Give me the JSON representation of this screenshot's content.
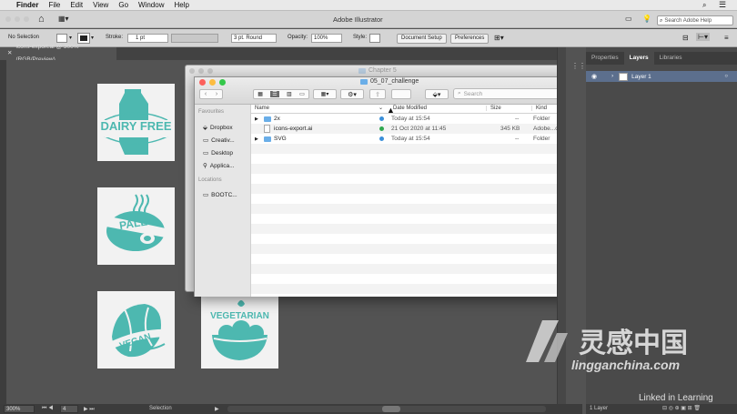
{
  "menubar": {
    "app": "Finder",
    "items": [
      "File",
      "Edit",
      "View",
      "Go",
      "Window",
      "Help"
    ]
  },
  "illustrator": {
    "title": "Adobe Illustrator",
    "search_placeholder": "Search Adobe Help",
    "control": {
      "selection": "No Selection",
      "stroke_label": "Stroke:",
      "stroke_value": "1 pt",
      "brush": "3 pt. Round",
      "opacity_label": "Opacity:",
      "opacity_value": "100%",
      "style_label": "Style:",
      "doc_setup": "Document Setup",
      "preferences": "Preferences"
    },
    "doc_tab": "icons-export.ai @ 300% (RGB/Preview)",
    "icons": [
      {
        "name": "dairy-free",
        "label": "DAIRY FREE"
      },
      {
        "name": "paleo",
        "label": "PALEO"
      },
      {
        "name": "vegan",
        "label": "VEGAN"
      },
      {
        "name": "vegetarian",
        "label": "VEGETARIAN"
      }
    ],
    "panel_tabs": [
      "Properties",
      "Layers",
      "Libraries"
    ],
    "layer_name": "Layer 1",
    "layers_count": "1 Layer",
    "status": {
      "zoom": "300%",
      "artboard": "4",
      "tool": "Selection"
    },
    "accent": "#4db8b0"
  },
  "finder": {
    "behind_title": "Chapter 5",
    "folder_title": "05_07_challenge",
    "search_placeholder": "Search",
    "sidebar": {
      "favourites_label": "Favourites",
      "favourites": [
        "Dropbox",
        "Creativ...",
        "Desktop",
        "Applica..."
      ],
      "locations_label": "Locations",
      "locations": [
        "BOOTC..."
      ]
    },
    "columns": {
      "name": "Name",
      "date": "Date Modified",
      "size": "Size",
      "kind": "Kind"
    },
    "rows": [
      {
        "name": "2x",
        "date": "Today at 15:54",
        "size": "--",
        "kind": "Folder"
      },
      {
        "name": "icons-export.ai",
        "date": "21 Oct 2020 at 11:45",
        "size": "345 KB",
        "kind": "Adobe...cument"
      },
      {
        "name": "SVG",
        "date": "Today at 15:54",
        "size": "--",
        "kind": "Folder"
      }
    ]
  },
  "watermark": {
    "brand_cn": "灵感中国",
    "brand_url": "lingganchina.com",
    "linkedin": "Linked in Learning"
  }
}
